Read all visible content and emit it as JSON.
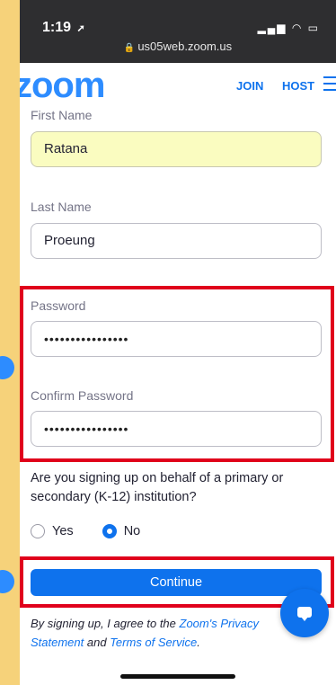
{
  "status_bar": {
    "time": "1:19",
    "location_glyph": "➚",
    "system_icons": "▂▄▆ ◠ ▭",
    "url": "us05web.zoom.us"
  },
  "nav": {
    "logo": "zoom",
    "join": "JOIN",
    "host": "HOST"
  },
  "form": {
    "first_name": {
      "label": "First Name",
      "value": "Ratana"
    },
    "last_name": {
      "label": "Last Name",
      "value": "Proeung"
    },
    "password": {
      "label": "Password",
      "value": "••••••••••••••••"
    },
    "confirm_password": {
      "label": "Confirm Password",
      "value": "••••••••••••••••"
    },
    "question": "Are you signing up on behalf of a primary or secondary (K-12) institution?",
    "options": {
      "yes": "Yes",
      "no": "No",
      "selected": "No"
    },
    "continue": "Continue"
  },
  "terms": {
    "prefix": "By signing up, I agree to the ",
    "privacy": "Zoom's Privacy Statement",
    "and": " and ",
    "tos": "Terms of Service",
    "suffix": "."
  },
  "colors": {
    "accent": "#0e72ed",
    "highlight": "#e0001b",
    "background": "#f6d27a"
  },
  "icons": {
    "chat": "chat-bubble-icon",
    "menu": "hamburger-menu-icon",
    "lock": "lock-icon"
  }
}
